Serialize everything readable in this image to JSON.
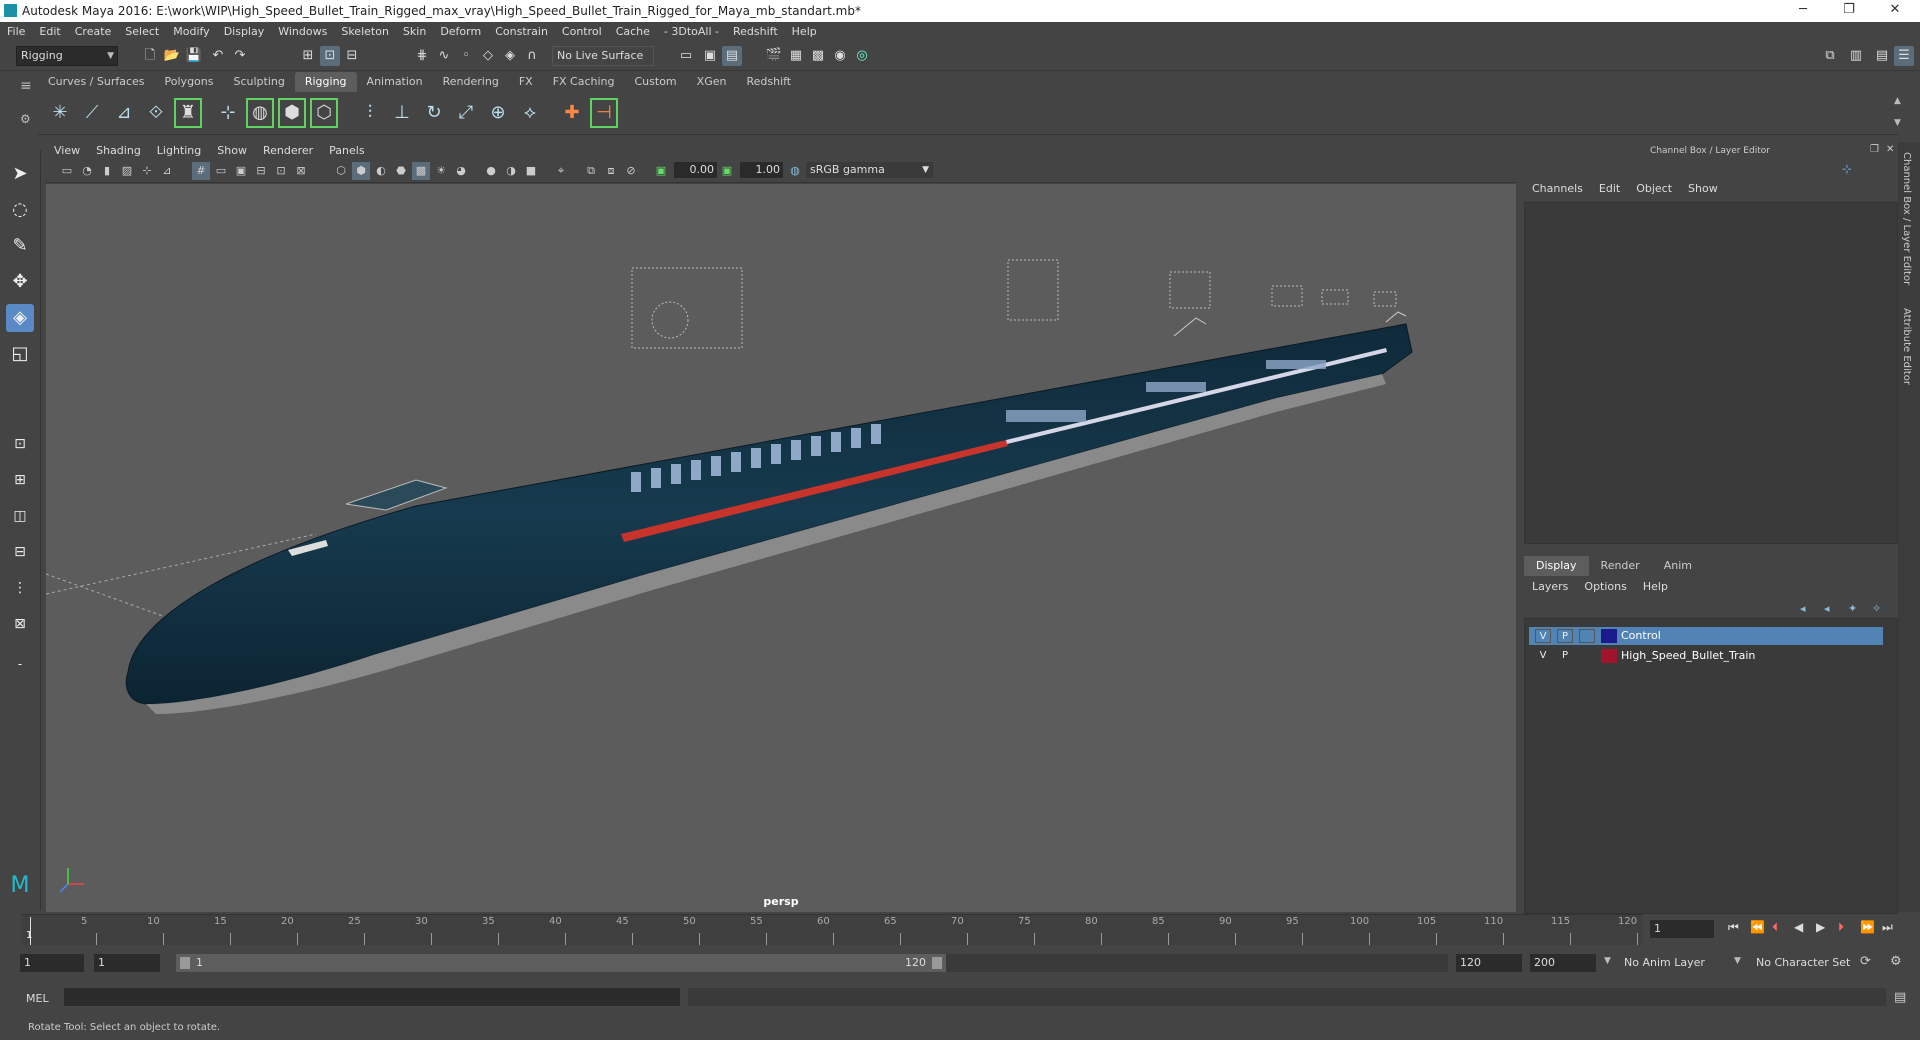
{
  "titlebar": {
    "title": "Autodesk Maya 2016: E:\\work\\WIP\\High_Speed_Bullet_Train_Rigged_max_vray\\High_Speed_Bullet_Train_Rigged_for_Maya_mb_standart.mb*",
    "minimize": "─",
    "restore": "❐",
    "close": "✕"
  },
  "menubar": [
    "File",
    "Edit",
    "Create",
    "Select",
    "Modify",
    "Display",
    "Windows",
    "Skeleton",
    "Skin",
    "Deform",
    "Constrain",
    "Control",
    "Cache",
    "- 3DtoAll -",
    "Redshift",
    "Help"
  ],
  "statusline": {
    "mode": "Rigging",
    "live_surface": "No Live Surface"
  },
  "shelf_tabs": [
    "Curves / Surfaces",
    "Polygons",
    "Sculpting",
    "Rigging",
    "Animation",
    "Rendering",
    "FX",
    "FX Caching",
    "Custom",
    "XGen",
    "Redshift"
  ],
  "shelf_active": "Rigging",
  "viewport": {
    "menu": [
      "View",
      "Shading",
      "Lighting",
      "Show",
      "Renderer",
      "Panels"
    ],
    "field1": "0.00",
    "field2": "1.00",
    "colorspace": "sRGB gamma",
    "camera": "persp"
  },
  "channel_box": {
    "header": "Channel Box / Layer Editor",
    "menu": [
      "Channels",
      "Edit",
      "Object",
      "Show"
    ]
  },
  "layer_editor": {
    "tabs": [
      "Display",
      "Render",
      "Anim"
    ],
    "active_tab": "Display",
    "menu": [
      "Layers",
      "Options",
      "Help"
    ],
    "layers": [
      {
        "v": "V",
        "p": "P",
        "color": "#1a1a8c",
        "name": "Control",
        "selected": true
      },
      {
        "v": "V",
        "p": "P",
        "color": "#a0142e",
        "name": "High_Speed_Bullet_Train",
        "selected": false
      }
    ]
  },
  "side_tabs": [
    "Channel Box / Layer Editor",
    "Attribute Editor"
  ],
  "timeline": {
    "labels": [
      "1",
      "5",
      "10",
      "15",
      "20",
      "25",
      "30",
      "35",
      "40",
      "45",
      "50",
      "55",
      "60",
      "65",
      "70",
      "75",
      "80",
      "85",
      "90",
      "95",
      "100",
      "105",
      "110",
      "115",
      "120"
    ],
    "current_frame": "1"
  },
  "range": {
    "start": "1",
    "playback_start": "1",
    "slider_start": "1",
    "slider_end": "120",
    "playback_end": "120",
    "end": "200",
    "anim_layer": "No Anim Layer",
    "char_set": "No Character Set"
  },
  "command": {
    "lang": "MEL",
    "help": "Rotate Tool: Select an object to rotate."
  }
}
